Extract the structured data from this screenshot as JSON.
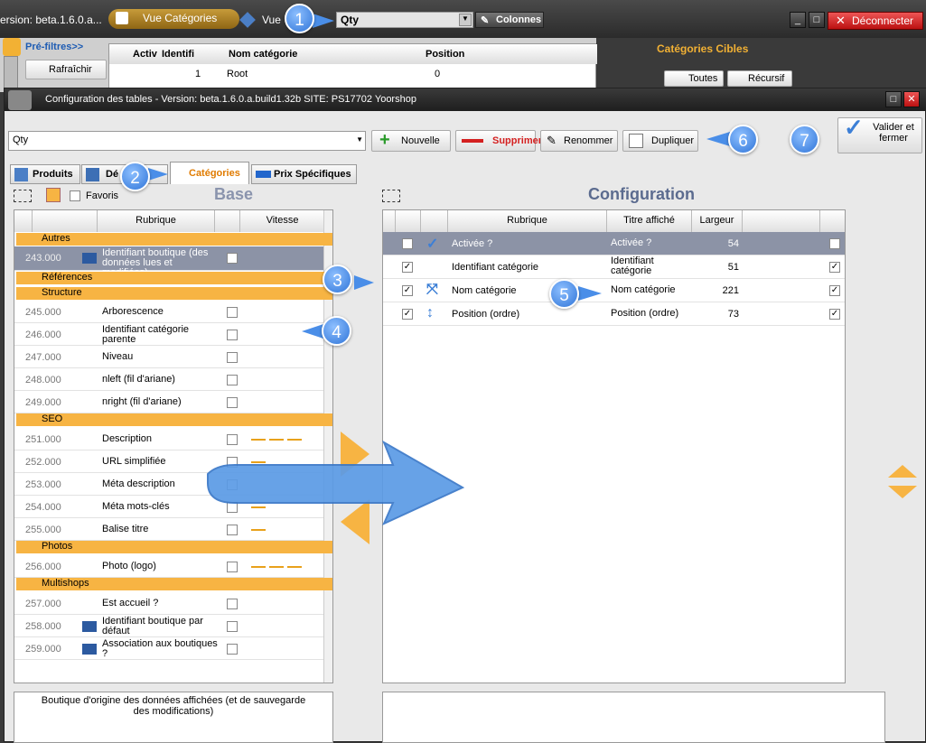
{
  "topbar": {
    "version": "ersion: beta.1.6.0.a...",
    "vue_categories": "Vue Catégories",
    "vue2": "Vue",
    "combo_value": "Qty",
    "colonnes": "Colonnes",
    "disconnect": "Déconnecter"
  },
  "background": {
    "prefiltres": "Pré-filtres>>",
    "rafraichir": "Rafraîchir",
    "col_active": "Activ",
    "col_identif": "Identifi",
    "col_nom": "Nom catégorie",
    "col_position": "Position",
    "row_id": "1",
    "row_name": "Root",
    "row_pos": "0",
    "cibles_title": "Catégories Cibles",
    "toutes": "Toutes",
    "recursif": "Récursif"
  },
  "dialog": {
    "title": "Configuration des tables  -  Version:  beta.1.6.0.a.build1.32b    SITE: PS17702 Yoorshop",
    "config_combo": "Qty",
    "nouvelle": "Nouvelle",
    "supprimer": "Supprimer",
    "renommer": "Renommer",
    "dupliquer": "Dupliquer",
    "valider": "Valider et fermer",
    "tabs": [
      "Produits",
      "Dé",
      "Catégories",
      "Prix Spécifiques"
    ],
    "favoris": "Favoris",
    "base_title": "Base",
    "config_title": "Configuration",
    "left_headers": {
      "rubrique": "Rubrique",
      "vitesse": "Vitesse"
    },
    "right_headers": {
      "rubrique": "Rubrique",
      "titre": "Titre affiché",
      "largeur": "Largeur"
    },
    "description": "Boutique d'origine des données affichées (et de sauvegarde des modifications)"
  },
  "callouts": [
    "1",
    "2",
    "3",
    "4",
    "5",
    "6",
    "7"
  ],
  "base": {
    "groups": {
      "autres": "Autres",
      "references": "Références",
      "structure": "Structure",
      "seo": "SEO",
      "photos": "Photos",
      "multishops": "Multishops"
    },
    "rows": [
      {
        "id": "243.000",
        "label": "Identifiant boutique (des données lues et modifiées)"
      },
      {
        "id": "245.000",
        "label": "Arborescence"
      },
      {
        "id": "246.000",
        "label": "Identifiant catégorie parente"
      },
      {
        "id": "247.000",
        "label": "Niveau"
      },
      {
        "id": "248.000",
        "label": "nleft (fil d'ariane)"
      },
      {
        "id": "249.000",
        "label": "nright (fil d'ariane)"
      },
      {
        "id": "251.000",
        "label": "Description"
      },
      {
        "id": "252.000",
        "label": "URL simplifiée"
      },
      {
        "id": "253.000",
        "label": "Méta description"
      },
      {
        "id": "254.000",
        "label": "Méta mots-clés"
      },
      {
        "id": "255.000",
        "label": "Balise titre"
      },
      {
        "id": "256.000",
        "label": "Photo (logo)"
      },
      {
        "id": "257.000",
        "label": "Est accueil ?"
      },
      {
        "id": "258.000",
        "label": "Identifiant boutique par défaut"
      },
      {
        "id": "259.000",
        "label": "Association aux boutiques ?"
      }
    ]
  },
  "config": {
    "rows": [
      {
        "rubrique": "Activée ?",
        "titre": "Activée ?",
        "largeur": "54"
      },
      {
        "rubrique": "Identifiant catégorie",
        "titre": "Identifiant catégorie",
        "largeur": "51"
      },
      {
        "rubrique": "Nom catégorie",
        "titre": "Nom catégorie",
        "largeur": "221"
      },
      {
        "rubrique": "Position (ordre)",
        "titre": "Position (ordre)",
        "largeur": "73"
      }
    ]
  },
  "colors": {
    "accent": "#f7b443",
    "selected": "#8c93a6",
    "callout": "#2f74d8"
  }
}
